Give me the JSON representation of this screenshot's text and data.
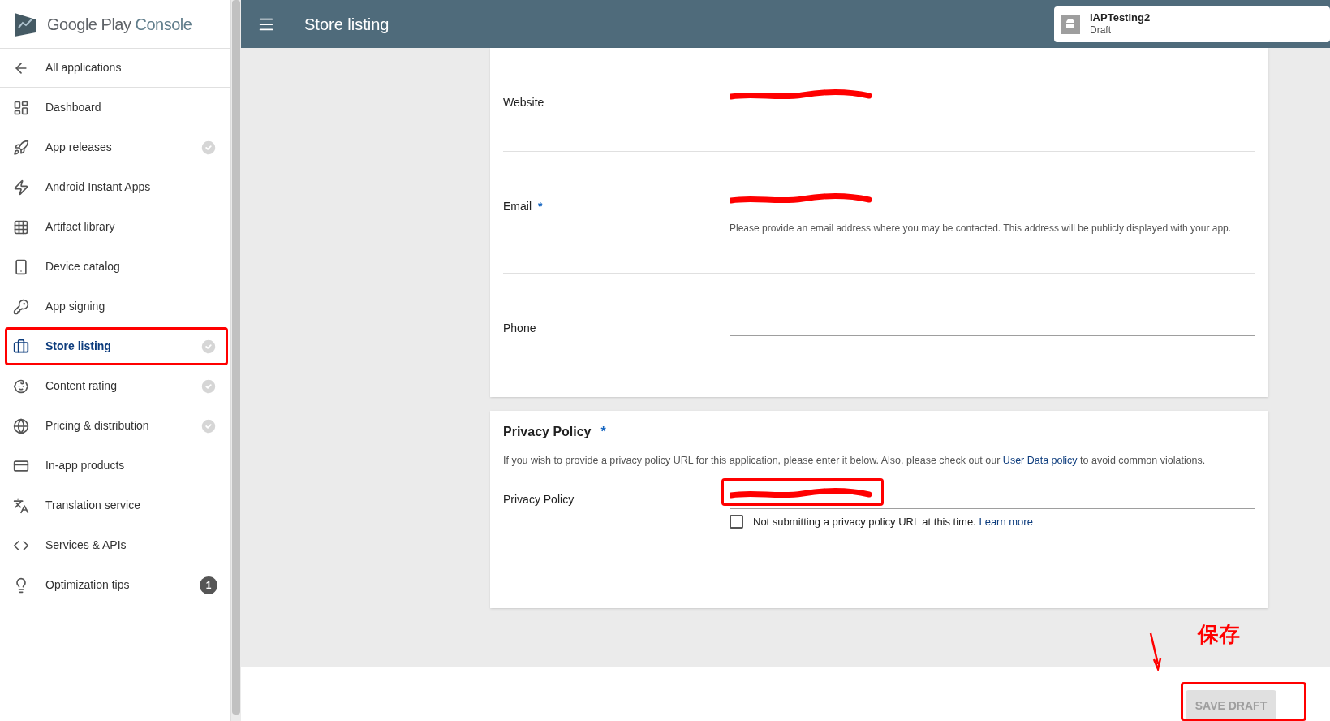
{
  "sidebar": {
    "logo": {
      "brand": "Google Play",
      "product": "Console"
    },
    "back_link": "All applications",
    "items": [
      {
        "label": "Dashboard",
        "selected": false,
        "kind": "plain"
      },
      {
        "label": "App releases",
        "selected": false,
        "kind": "check"
      },
      {
        "label": "Android Instant Apps",
        "selected": false,
        "kind": "plain"
      },
      {
        "label": "Artifact library",
        "selected": false,
        "kind": "plain"
      },
      {
        "label": "Device catalog",
        "selected": false,
        "kind": "plain"
      },
      {
        "label": "App signing",
        "selected": false,
        "kind": "plain"
      },
      {
        "label": "Store listing",
        "selected": true,
        "kind": "check"
      },
      {
        "label": "Content rating",
        "selected": false,
        "kind": "check"
      },
      {
        "label": "Pricing & distribution",
        "selected": false,
        "kind": "check"
      },
      {
        "label": "In-app products",
        "selected": false,
        "kind": "plain"
      },
      {
        "label": "Translation service",
        "selected": false,
        "kind": "plain"
      },
      {
        "label": "Services & APIs",
        "selected": false,
        "kind": "plain"
      },
      {
        "label": "Optimization tips",
        "selected": false,
        "kind": "count",
        "badge": "1"
      }
    ]
  },
  "topbar": {
    "title": "Store listing",
    "app": {
      "name": "IAPTesting2",
      "status": "Draft"
    }
  },
  "contact_card": {
    "fields": [
      {
        "label": "Website",
        "redacted": true
      },
      {
        "label": "Email",
        "marker": "*",
        "redacted": true,
        "helper": "Please provide an email address where you may be contacted. This address will be publicly displayed with your app."
      },
      {
        "label": "Phone",
        "redacted": false
      }
    ]
  },
  "privacy_card": {
    "title": "Privacy Policy",
    "title_marker": "*",
    "description_before": "If you wish to provide a privacy policy URL for this application, please enter it below. Also, please check out our",
    "description_link": "User Data policy",
    "description_after": "to avoid common violations.",
    "field": {
      "label": "Privacy Policy",
      "redacted": true
    },
    "checkbox": {
      "label": "Not submitting a privacy policy URL at this time.",
      "link": "Learn more",
      "checked": false
    }
  },
  "footer": {
    "save_button": {
      "label": "SAVE DRAFT",
      "disabled": true
    }
  },
  "annotation": {
    "caption": "保存"
  }
}
